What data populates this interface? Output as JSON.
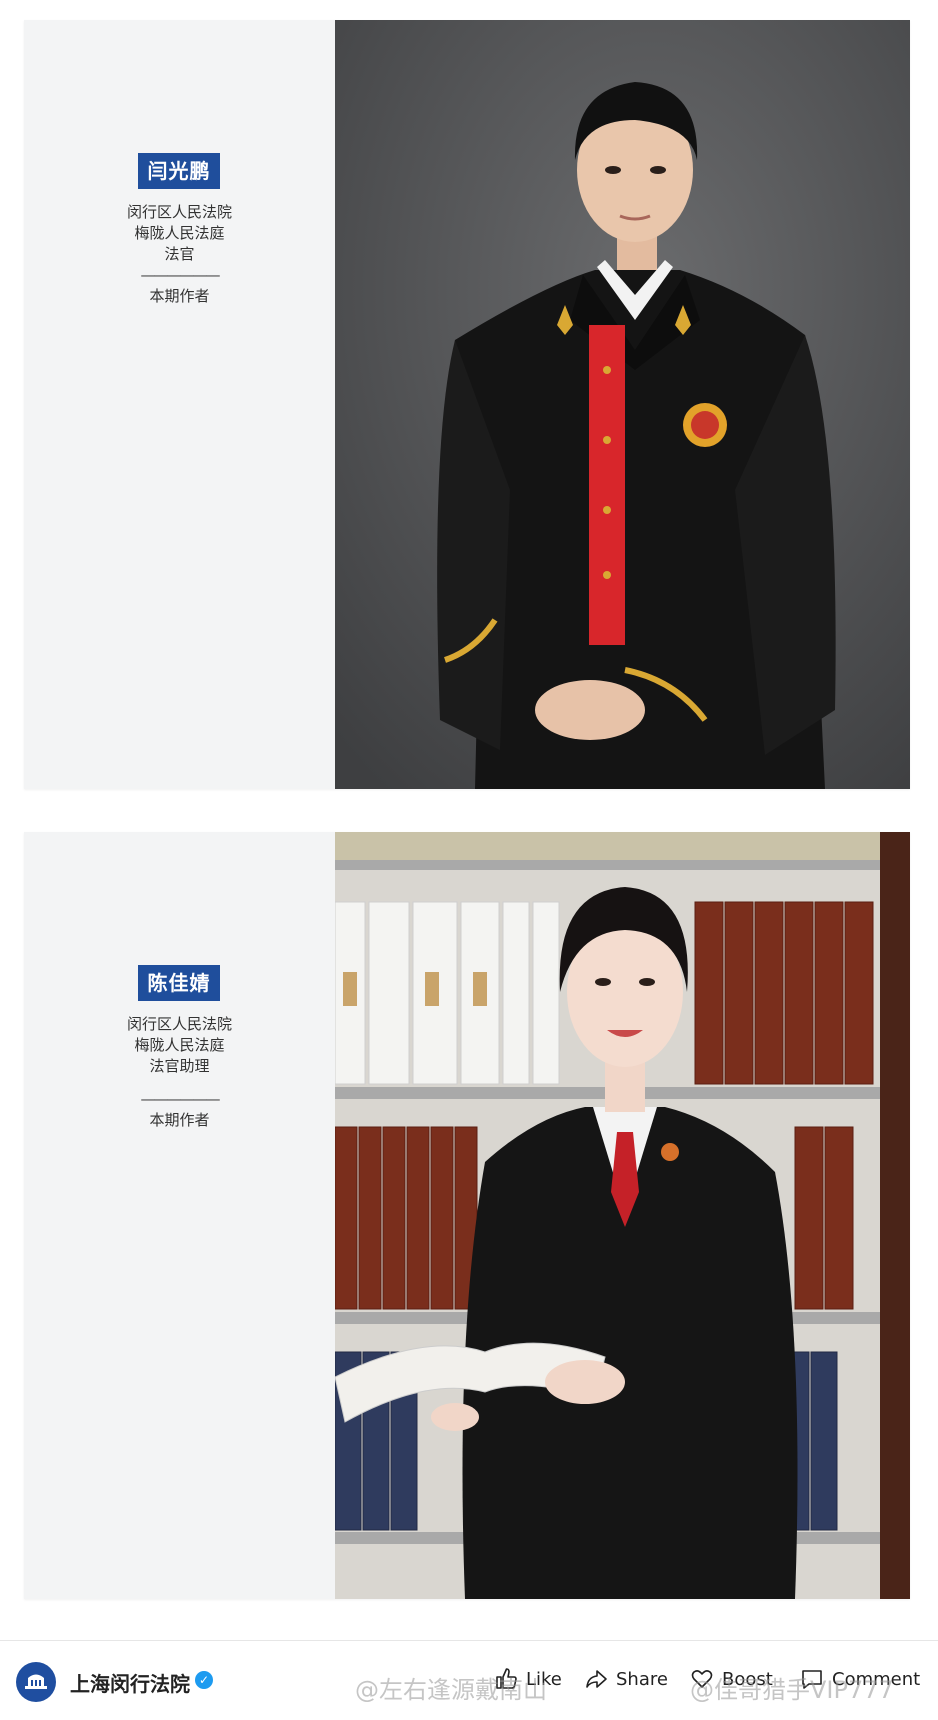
{
  "profiles": [
    {
      "name": "闫光鹏",
      "lines": [
        "闵行区人民法院",
        "梅陇人民法庭",
        "法官"
      ],
      "divider": "——————",
      "footer": "本期作者"
    },
    {
      "name": "陈佳婧",
      "lines": [
        "闵行区人民法院",
        "梅陇人民法庭",
        "法官助理"
      ],
      "divider": "——————",
      "footer": "本期作者"
    }
  ],
  "account": {
    "name": "上海闵行法院",
    "verified": true
  },
  "actions": {
    "like": "Like",
    "share": "Share",
    "boost": "Boost",
    "comment": "Comment"
  },
  "watermarks": {
    "left": "@左右逢源戴南山",
    "right": "@佳哥猎手VIP777"
  },
  "colors": {
    "name_tag": "#1f4e9c",
    "card_bg": "#f3f4f5",
    "verified": "#1d9bf0"
  },
  "icons": [
    "thumbs-up-icon",
    "share-arrow-icon",
    "heart-icon",
    "comment-icon",
    "verified-badge-icon"
  ]
}
